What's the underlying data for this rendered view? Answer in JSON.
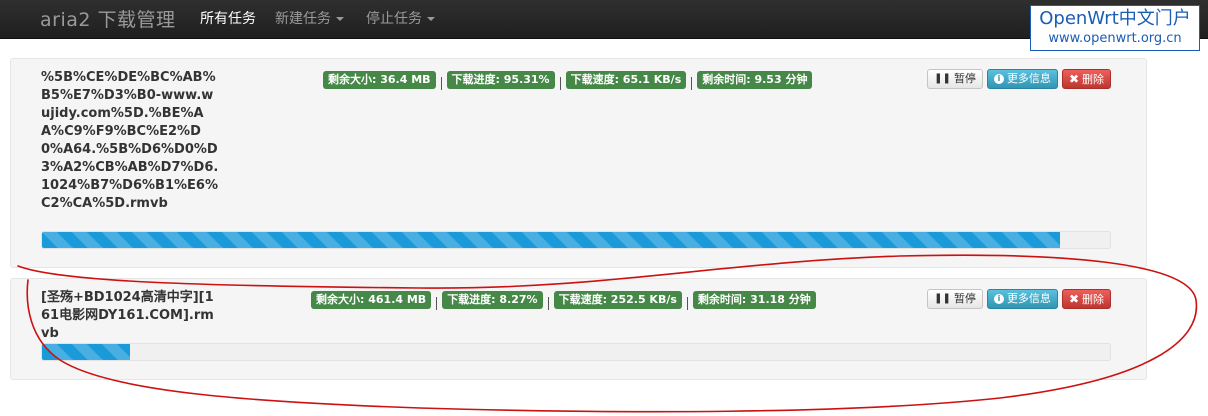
{
  "app": {
    "brand": "aria2 下载管理",
    "nav": {
      "all_tasks": "所有任务",
      "new_task": "新建任务",
      "stop_task": "停止任务"
    }
  },
  "watermark": {
    "name": "OpenWrt中文门户",
    "url": "www.openwrt.org.cn"
  },
  "labels": {
    "pause": "暂停",
    "more_info": "更多信息",
    "delete": "删除"
  },
  "tasks": [
    {
      "name": "%5B%CE%DE%BC%AB%B5%E7%D3%B0-www.wujidy.com%5D.%BE%AA%C9%F9%BC%E2%D0%A64.%5B%D6%D0%D3%A2%CB%AB%D7%D6.1024%B7%D6%B1%E6%C2%CA%5D.rmvb",
      "remaining_size": "剩余大小: 36.4 MB",
      "progress_text": "下载进度: 95.31%",
      "speed": "下载速度: 65.1 KB/s",
      "time_left": "剩余时间: 9.53 分钟",
      "progress": 95.31
    },
    {
      "name": "[圣殇+BD1024高清中字][161电影网DY161.COM].rmvb",
      "remaining_size": "剩余大小: 461.4 MB",
      "progress_text": "下载进度: 8.27%",
      "speed": "下载速度: 252.5 KB/s",
      "time_left": "剩余时间: 31.18 分钟",
      "progress": 8.27
    }
  ],
  "colors": {
    "badge_green": "#468847",
    "progress_blue": "#1b9ad9",
    "annotation_red": "#cc1111"
  }
}
